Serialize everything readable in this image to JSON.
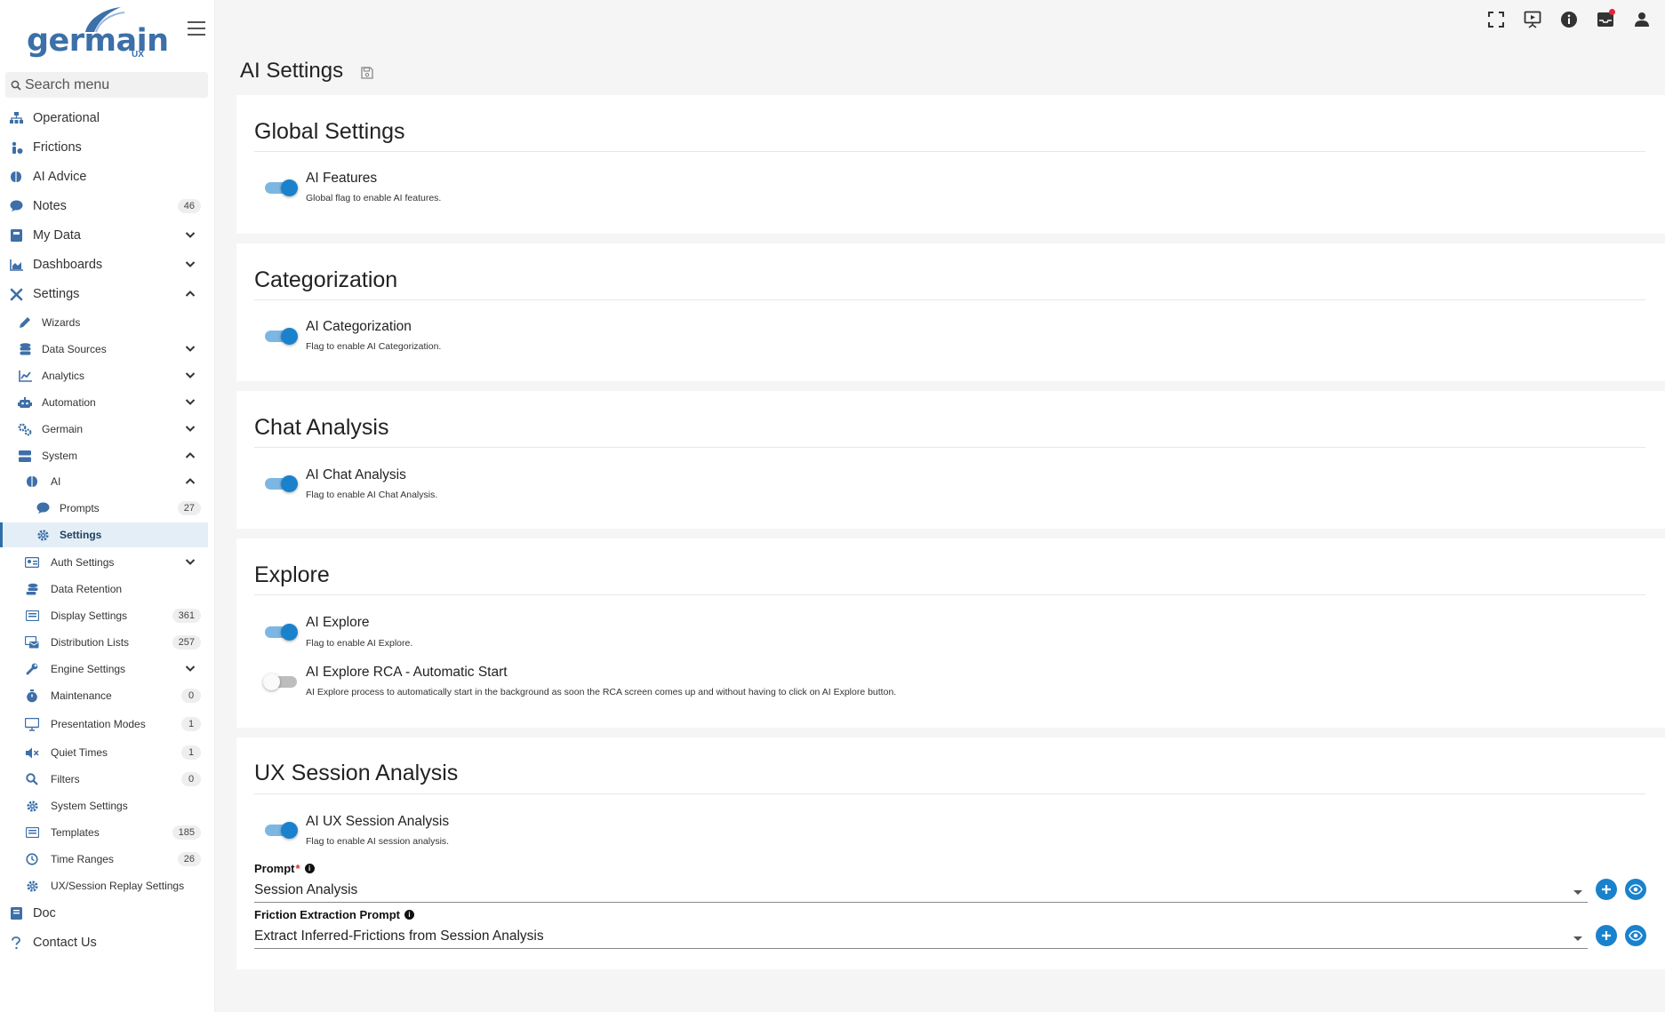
{
  "brand": {
    "name": "germain",
    "sub": "UX"
  },
  "search": {
    "placeholder": "Search menu"
  },
  "nav": {
    "operational": "Operational",
    "frictions": "Frictions",
    "ai_advice": "AI Advice",
    "notes": {
      "label": "Notes",
      "count": "46"
    },
    "my_data": "My Data",
    "dashboards": "Dashboards",
    "settings": "Settings",
    "wizards": "Wizards",
    "data_sources": "Data Sources",
    "analytics": "Analytics",
    "automation": "Automation",
    "germain": "Germain",
    "system": "System",
    "ai": "AI",
    "prompts": {
      "label": "Prompts",
      "count": "27"
    },
    "ai_settings": "Settings",
    "auth_settings": "Auth Settings",
    "data_retention": "Data Retention",
    "display_settings": {
      "label": "Display Settings",
      "count": "361"
    },
    "distribution_lists": {
      "label": "Distribution Lists",
      "count": "257"
    },
    "engine_settings": "Engine Settings",
    "maintenance": {
      "label": "Maintenance",
      "count": "0"
    },
    "presentation_modes": {
      "label": "Presentation Modes",
      "count": "1"
    },
    "quiet_times": {
      "label": "Quiet Times",
      "count": "1"
    },
    "filters": {
      "label": "Filters",
      "count": "0"
    },
    "system_settings": "System Settings",
    "templates": {
      "label": "Templates",
      "count": "185"
    },
    "time_ranges": {
      "label": "Time Ranges",
      "count": "26"
    },
    "ux_replay": "UX/Session Replay Settings",
    "doc": "Doc",
    "contact": "Contact Us"
  },
  "page": {
    "title": "AI Settings"
  },
  "sections": {
    "global": {
      "title": "Global Settings",
      "ai_features": {
        "label": "AI Features",
        "desc": "Global flag to enable AI features.",
        "enabled": true
      }
    },
    "categorization": {
      "title": "Categorization",
      "ai_categorization": {
        "label": "AI Categorization",
        "desc": "Flag to enable AI Categorization.",
        "enabled": true
      }
    },
    "chat": {
      "title": "Chat Analysis",
      "ai_chat": {
        "label": "AI Chat Analysis",
        "desc": "Flag to enable AI Chat Analysis.",
        "enabled": true
      }
    },
    "explore": {
      "title": "Explore",
      "ai_explore": {
        "label": "AI Explore",
        "desc": "Flag to enable AI Explore.",
        "enabled": true
      },
      "ai_explore_rca": {
        "label": "AI Explore RCA - Automatic Start",
        "desc": "AI Explore process to automatically start in the background as soon the RCA screen comes up and without having to click on AI Explore button.",
        "enabled": false
      }
    },
    "ux": {
      "title": "UX Session Analysis",
      "ai_ux": {
        "label": "AI UX Session Analysis",
        "desc": "Flag to enable AI session analysis.",
        "enabled": true
      },
      "prompt": {
        "label": "Prompt",
        "required": "*",
        "value": "Session Analysis"
      },
      "friction_prompt": {
        "label": "Friction Extraction Prompt",
        "value": "Extract Inferred-Frictions from Session Analysis"
      }
    }
  },
  "colors": {
    "accent": "#1a82cc",
    "brand": "#3d6fa8",
    "active_bg": "#e4eef7"
  }
}
